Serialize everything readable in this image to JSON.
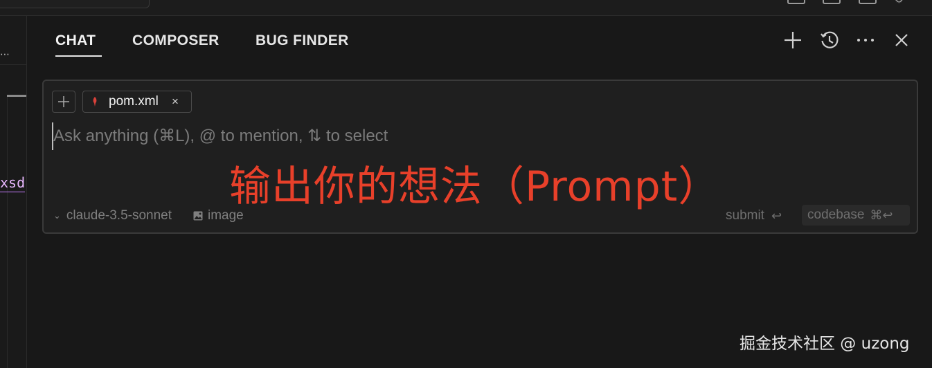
{
  "tabs": [
    {
      "label": "CHAT",
      "active": true
    },
    {
      "label": "COMPOSER",
      "active": false
    },
    {
      "label": "BUG FINDER",
      "active": false
    }
  ],
  "actions": {
    "new_chat_icon": "plus-icon",
    "history_icon": "history-icon",
    "more_icon": "more-horizontal-icon",
    "close_icon": "close-icon"
  },
  "left_pane": {
    "overflow_glyph": "⋯",
    "code_fragment": "xsd"
  },
  "composer": {
    "context_chip": {
      "label": "pom.xml",
      "remove_glyph": "×",
      "icon": "maven-feather-icon",
      "icon_color": "#d9413a"
    },
    "placeholder": "Ask anything (⌘L), @ to mention, ⇅ to select",
    "value": "",
    "annotation": "输出你的想法（Prompt）",
    "annotation_color": "#e8402a",
    "model": "claude-3.5-sonnet",
    "image_label": "image",
    "submit_label": "submit",
    "submit_key": "↩",
    "codebase_label": "codebase",
    "codebase_key": "⌘↩"
  },
  "watermark": "掘金技术社区 @ uzong"
}
